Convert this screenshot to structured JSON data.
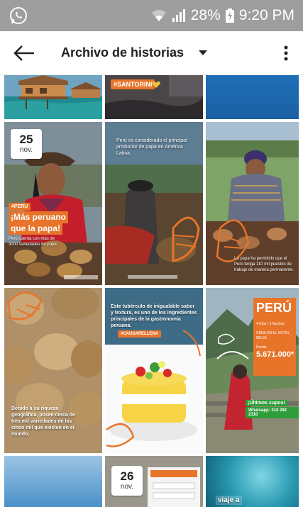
{
  "status_bar": {
    "battery": "28%",
    "time": "9:20 PM"
  },
  "app_bar": {
    "title": "Archivo de historias"
  },
  "stories": [
    {
      "tag": "#SANTORINI"
    },
    {
      "date_day": "25",
      "date_month": "nov.",
      "tag": "#PERU",
      "headline_line1": "¡Más peruano",
      "headline_line2": "que la papa!",
      "caption": "Perú cuenta con más de 3000 variedades de papa."
    },
    {
      "caption": "Perú es considerado el principal productor de papa en América Latina."
    },
    {
      "caption": "La papa ha permitido que el Perú tenga 110 mil puestos de trabajo de manera permanente."
    },
    {
      "caption": "Debido a su riqueza geográfica, posee cerca de tres mil variedades de las cinco mil que existen en el mundo."
    },
    {
      "caption": "Este tubérculo de inigualable sabor y textura, es uno de los ingredientes principales de la gastronomía peruana.",
      "tag": "#CAUSARELLENA"
    },
    {
      "card_title": "PERÚ",
      "card_details": "4 Días / 3 Noches",
      "card_hotel": "CENA EN EL HOTEL MELIÁ",
      "price_label": "Desde",
      "price": "5.671.000*",
      "button_label": "¡Últimos cupos!",
      "whatsapp": "Whatsapp: 310 282 2310"
    },
    {
      "label": ""
    },
    {
      "date_day": "26",
      "date_month": "nov."
    },
    {
      "caption": "viaje a"
    }
  ],
  "colors": {
    "status_bar": "#9e9e9e",
    "accent_orange": "#e8742a",
    "green": "#2f9e3a"
  },
  "icons": [
    "whatsapp-icon",
    "wifi-icon",
    "signal-icon",
    "battery-icon",
    "back-arrow-icon",
    "dropdown-arrow-icon",
    "more-vert-icon"
  ]
}
